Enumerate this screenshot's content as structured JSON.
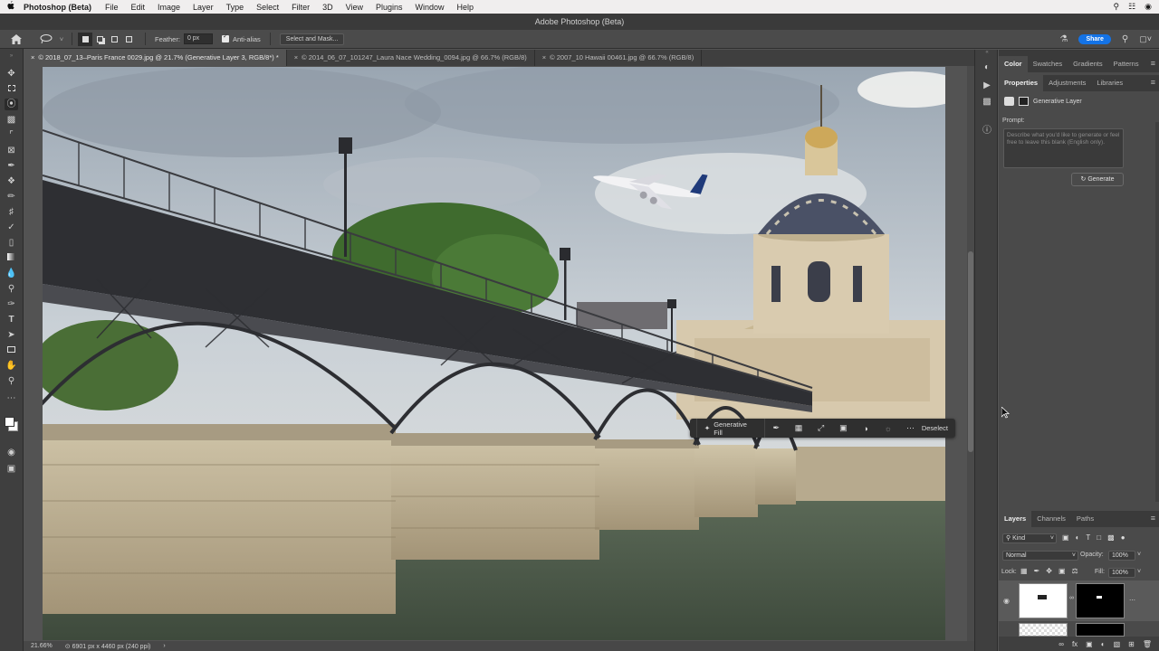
{
  "menubar": {
    "apple": "",
    "app_name": "Photoshop (Beta)",
    "items": [
      "File",
      "Edit",
      "Image",
      "Layer",
      "Type",
      "Select",
      "Filter",
      "3D",
      "View",
      "Plugins",
      "Window",
      "Help"
    ]
  },
  "window": {
    "title": "Adobe Photoshop (Beta)"
  },
  "options": {
    "feather_label": "Feather:",
    "feather_value": "0 px",
    "antialias_label": "Anti-alias",
    "select_mask_label": "Select and Mask...",
    "share_label": "Share"
  },
  "tabs": [
    {
      "label": "© 2018_07_13–Paris France 0029.jpg @ 21.7% (Generative Layer 3, RGB/8*) *",
      "active": true
    },
    {
      "label": "© 2014_06_07_101247_Laura Nace Wedding_0094.jpg @ 66.7% (RGB/8)",
      "active": false
    },
    {
      "label": "© 2007_10 Hawaii 00461.jpg @ 66.7% (RGB/8)",
      "active": false
    }
  ],
  "status": {
    "zoom": "21.66%",
    "doc_info": "6901 px x 4460 px (240 ppi)"
  },
  "taskbar": {
    "gen_fill": "Generative Fill",
    "deselect": "Deselect"
  },
  "color_panel": {
    "tabs": [
      "Color",
      "Swatches",
      "Gradients",
      "Patterns"
    ]
  },
  "properties_panel": {
    "tabs": [
      "Properties",
      "Adjustments",
      "Libraries"
    ],
    "layer_type": "Generative Layer",
    "prompt_label": "Prompt:",
    "prompt_placeholder": "Describe what you'd like to generate or feel free to leave this blank (English only).",
    "generate_label": "Generate"
  },
  "layers_panel": {
    "tabs": [
      "Layers",
      "Channels",
      "Paths"
    ],
    "kind_label": "Kind",
    "blend_mode": "Normal",
    "opacity_label": "Opacity:",
    "opacity_value": "100%",
    "lock_label": "Lock:",
    "fill_label": "Fill:",
    "fill_value": "100%"
  }
}
